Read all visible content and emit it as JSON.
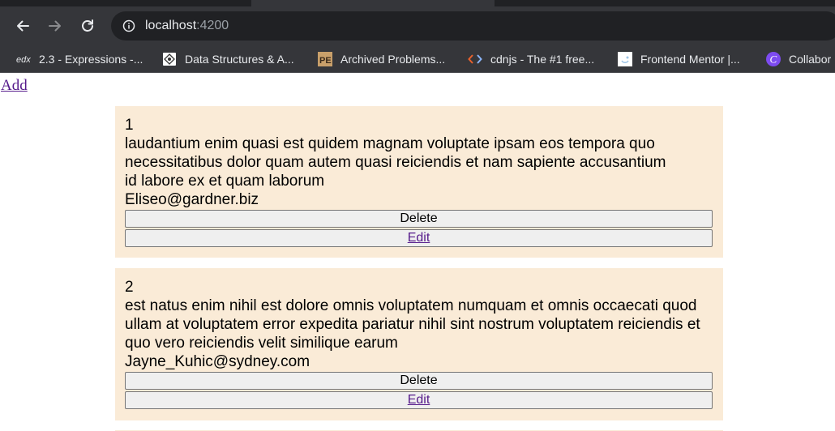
{
  "browser": {
    "url_host": "localhost",
    "url_port": ":4200"
  },
  "bookmarks": [
    {
      "label": "2.3 - Expressions -...",
      "icon": "edx-icon"
    },
    {
      "label": "Data Structures & A...",
      "icon": "book-icon"
    },
    {
      "label": "Archived Problems...",
      "icon": "project-euler-icon"
    },
    {
      "label": "cdnjs - The #1 free...",
      "icon": "code-brackets-icon"
    },
    {
      "label": "Frontend Mentor |...",
      "icon": "frontend-mentor-icon"
    },
    {
      "label": "Collabor",
      "icon": "canva-icon"
    }
  ],
  "page": {
    "add_label": "Add",
    "posts": [
      {
        "id": "1",
        "title": "laudantium enim quasi est quidem magnam voluptate ipsam eos tempora quo necessitatibus dolor quam autem quasi reiciendis et nam sapiente accusantium",
        "body": "id labore ex et quam laborum",
        "email": "Eliseo@gardner.biz",
        "delete_label": "Delete",
        "edit_label": "Edit"
      },
      {
        "id": "2",
        "title": "est natus enim nihil est dolore omnis voluptatem numquam et omnis occaecati quod ullam at voluptatem error expedita pariatur nihil sint nostrum voluptatem reiciendis et",
        "body": "quo vero reiciendis velit similique earum",
        "email": "Jayne_Kuhic@sydney.com",
        "delete_label": "Delete",
        "edit_label": "Edit"
      }
    ]
  },
  "colors": {
    "card_bg": "#faebd7",
    "link": "#551a8b",
    "chrome_bg": "#35363a"
  }
}
